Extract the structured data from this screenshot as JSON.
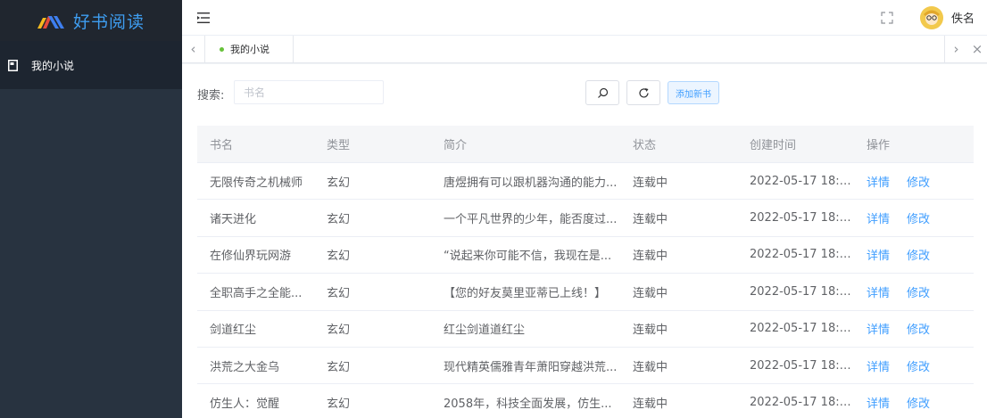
{
  "app": {
    "title": "好书阅读"
  },
  "sidebar": {
    "items": [
      {
        "label": "我的小说"
      }
    ]
  },
  "header": {
    "username": "佚名"
  },
  "tabs": {
    "items": [
      {
        "label": "我的小说"
      }
    ]
  },
  "search": {
    "label": "搜索:",
    "placeholder": "书名",
    "add_button": "添加新书"
  },
  "table": {
    "columns": [
      "书名",
      "类型",
      "简介",
      "状态",
      "创建时间",
      "操作"
    ],
    "rows": [
      {
        "name": "无限传奇之机械师",
        "type": "玄幻",
        "intro": "唐煜拥有可以跟机器沟通的能力...",
        "status": "连载中",
        "created": "2022-05-17 18:2...",
        "detail": "详情",
        "edit": "修改"
      },
      {
        "name": "诸天进化",
        "type": "玄幻",
        "intro": "一个平凡世界的少年，能否度过...",
        "status": "连载中",
        "created": "2022-05-17 18:2...",
        "detail": "详情",
        "edit": "修改"
      },
      {
        "name": "在修仙界玩网游",
        "type": "玄幻",
        "intro": "“说起来你可能不信，我现在是...",
        "status": "连载中",
        "created": "2022-05-17 18:2...",
        "detail": "详情",
        "edit": "修改"
      },
      {
        "name": "全职高手之全能...",
        "type": "玄幻",
        "intro": "【您的好友莫里亚蒂已上线！】",
        "status": "连载中",
        "created": "2022-05-17 18:2...",
        "detail": "详情",
        "edit": "修改"
      },
      {
        "name": "剑道红尘",
        "type": "玄幻",
        "intro": "红尘剑道道红尘",
        "status": "连载中",
        "created": "2022-05-17 18:2...",
        "detail": "详情",
        "edit": "修改"
      },
      {
        "name": "洪荒之大金乌",
        "type": "玄幻",
        "intro": "现代精英儒雅青年萧阳穿越洪荒...",
        "status": "连载中",
        "created": "2022-05-17 18:2...",
        "detail": "详情",
        "edit": "修改"
      },
      {
        "name": "仿生人：觉醒",
        "type": "玄幻",
        "intro": "2058年，科技全面发展，仿生...",
        "status": "连载中",
        "created": "2022-05-17 18:2...",
        "detail": "详情",
        "edit": "修改"
      }
    ]
  },
  "colors": {
    "sidebar_bg": "#283340",
    "logo_text": "#3e9df0",
    "link": "#409eff",
    "active_dot": "#67c23a"
  },
  "icons": [
    "logo-icon",
    "document-icon",
    "hamburger-icon",
    "fullscreen-icon",
    "avatar",
    "chevron-left-icon",
    "chevron-right-icon",
    "close-icon",
    "search-icon",
    "refresh-icon"
  ]
}
